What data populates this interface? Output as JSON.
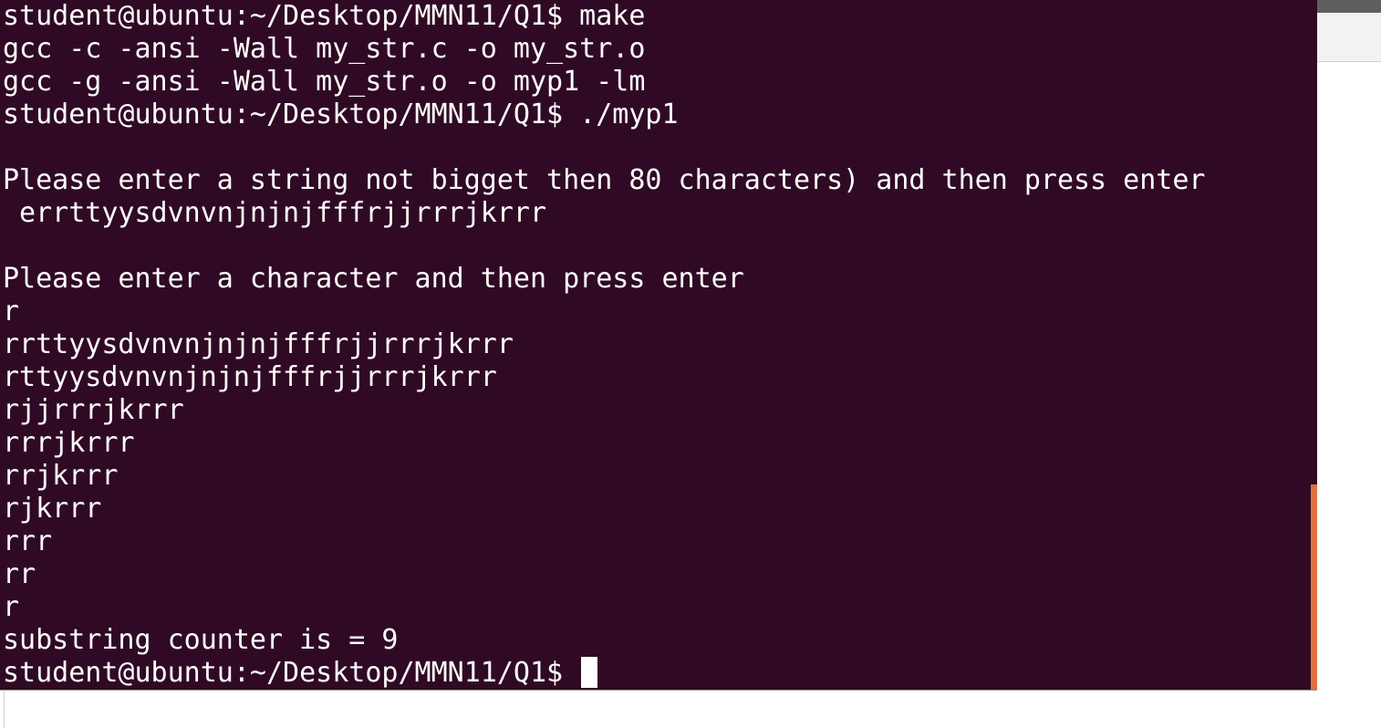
{
  "terminal": {
    "background": "#300a24",
    "text_color": "#ffffff",
    "scrollbar_color": "#e0703f",
    "lines": [
      "student@ubuntu:~/Desktop/MMN11/Q1$ make",
      "gcc -c -ansi -Wall my_str.c -o my_str.o",
      "gcc -g -ansi -Wall my_str.o -o myp1 -lm",
      "student@ubuntu:~/Desktop/MMN11/Q1$ ./myp1",
      "",
      "Please enter a string not bigget then 80 characters) and then press enter",
      " errttyysdvnvnjnjnjfffrjjrrrjkrrr",
      "",
      "Please enter a character and then press enter",
      "r",
      "rrttyysdvnvnjnjnjfffrjjrrrjkrrr",
      "rttyysdvnvnjnjnjfffrjjrrrjkrrr",
      "rjjrrrjkrrr",
      "rrrjkrrr",
      "rrjkrrr",
      "rjkrrr",
      "rrr",
      "rr",
      "r",
      "substring counter is = 9"
    ],
    "prompt": "student@ubuntu:~/Desktop/MMN11/Q1$ "
  }
}
